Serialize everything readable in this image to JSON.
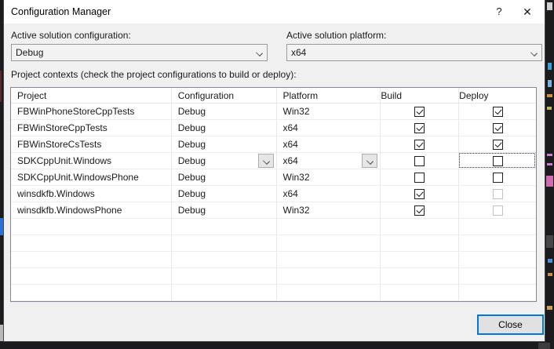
{
  "window": {
    "title": "Configuration Manager",
    "help_label": "?",
    "close_label": "✕"
  },
  "fields": {
    "config_label": "Active solution configuration:",
    "config_value": "Debug",
    "platform_label": "Active solution platform:",
    "platform_value": "x64"
  },
  "table": {
    "caption": "Project contexts (check the project configurations to build or deploy):",
    "columns": [
      "Project",
      "Configuration",
      "Platform",
      "Build",
      "Deploy"
    ],
    "rows": [
      {
        "project": "FBWinPhoneStoreCppTests",
        "configuration": "Debug",
        "platform": "Win32",
        "build": "checked",
        "deploy": "checked",
        "editing": false,
        "deploy_focused": false
      },
      {
        "project": "FBWinStoreCppTests",
        "configuration": "Debug",
        "platform": "x64",
        "build": "checked",
        "deploy": "checked",
        "editing": false,
        "deploy_focused": false
      },
      {
        "project": "FBWinStoreCsTests",
        "configuration": "Debug",
        "platform": "x64",
        "build": "checked",
        "deploy": "checked",
        "editing": false,
        "deploy_focused": false
      },
      {
        "project": "SDKCppUnit.Windows",
        "configuration": "Debug",
        "platform": "x64",
        "build": "unchecked",
        "deploy": "unchecked",
        "editing": true,
        "deploy_focused": true
      },
      {
        "project": "SDKCppUnit.WindowsPhone",
        "configuration": "Debug",
        "platform": "Win32",
        "build": "unchecked",
        "deploy": "unchecked",
        "editing": false,
        "deploy_focused": false
      },
      {
        "project": "winsdkfb.Windows",
        "configuration": "Debug",
        "platform": "x64",
        "build": "checked",
        "deploy": "disabled",
        "editing": false,
        "deploy_focused": false
      },
      {
        "project": "winsdkfb.WindowsPhone",
        "configuration": "Debug",
        "platform": "Win32",
        "build": "checked",
        "deploy": "disabled",
        "editing": false,
        "deploy_focused": false
      }
    ],
    "empty_row_count": 5
  },
  "buttons": {
    "close": "Close"
  },
  "colors": {
    "accent": "#0078d7",
    "dialog_bg": "#f0f0f0",
    "titlebar_bg": "#ffffff",
    "table_border": "#828790",
    "grid_line": "#e9e9e9",
    "checkbox_border": "#1f1f1f",
    "disabled_checkbox_border": "#c3c3c3"
  }
}
